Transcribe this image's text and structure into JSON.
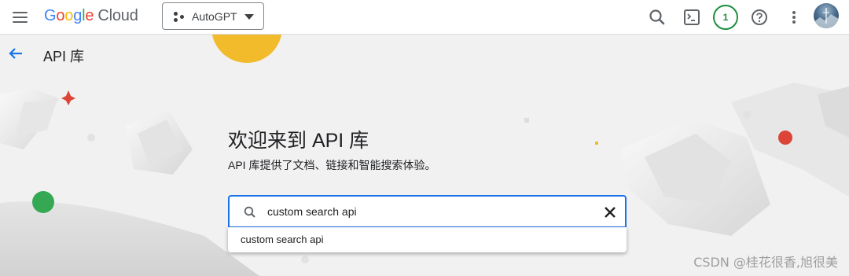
{
  "header": {
    "logo_google": [
      "G",
      "o",
      "o",
      "g",
      "l",
      "e"
    ],
    "logo_google_colors": [
      "#4285f4",
      "#ea4335",
      "#fbbc05",
      "#4285f4",
      "#34a853",
      "#ea4335"
    ],
    "logo_cloud": "Cloud",
    "project_name": "AutoGPT",
    "notification_count": "1",
    "icons": [
      "menu-icon",
      "search-icon",
      "terminal-icon",
      "help-icon",
      "more-vert-icon"
    ]
  },
  "subheader": {
    "title": "API 库",
    "back_icon": "arrow-back-icon"
  },
  "hero": {
    "title": "欢迎来到 API 库",
    "subtitle": "API 库提供了文档、链接和智能搜索体验。"
  },
  "search": {
    "value": "custom search api",
    "suggestions": [
      "custom search api"
    ],
    "accent_color": "#1a73e8"
  },
  "watermark": "CSDN @桂花很香,旭很美"
}
